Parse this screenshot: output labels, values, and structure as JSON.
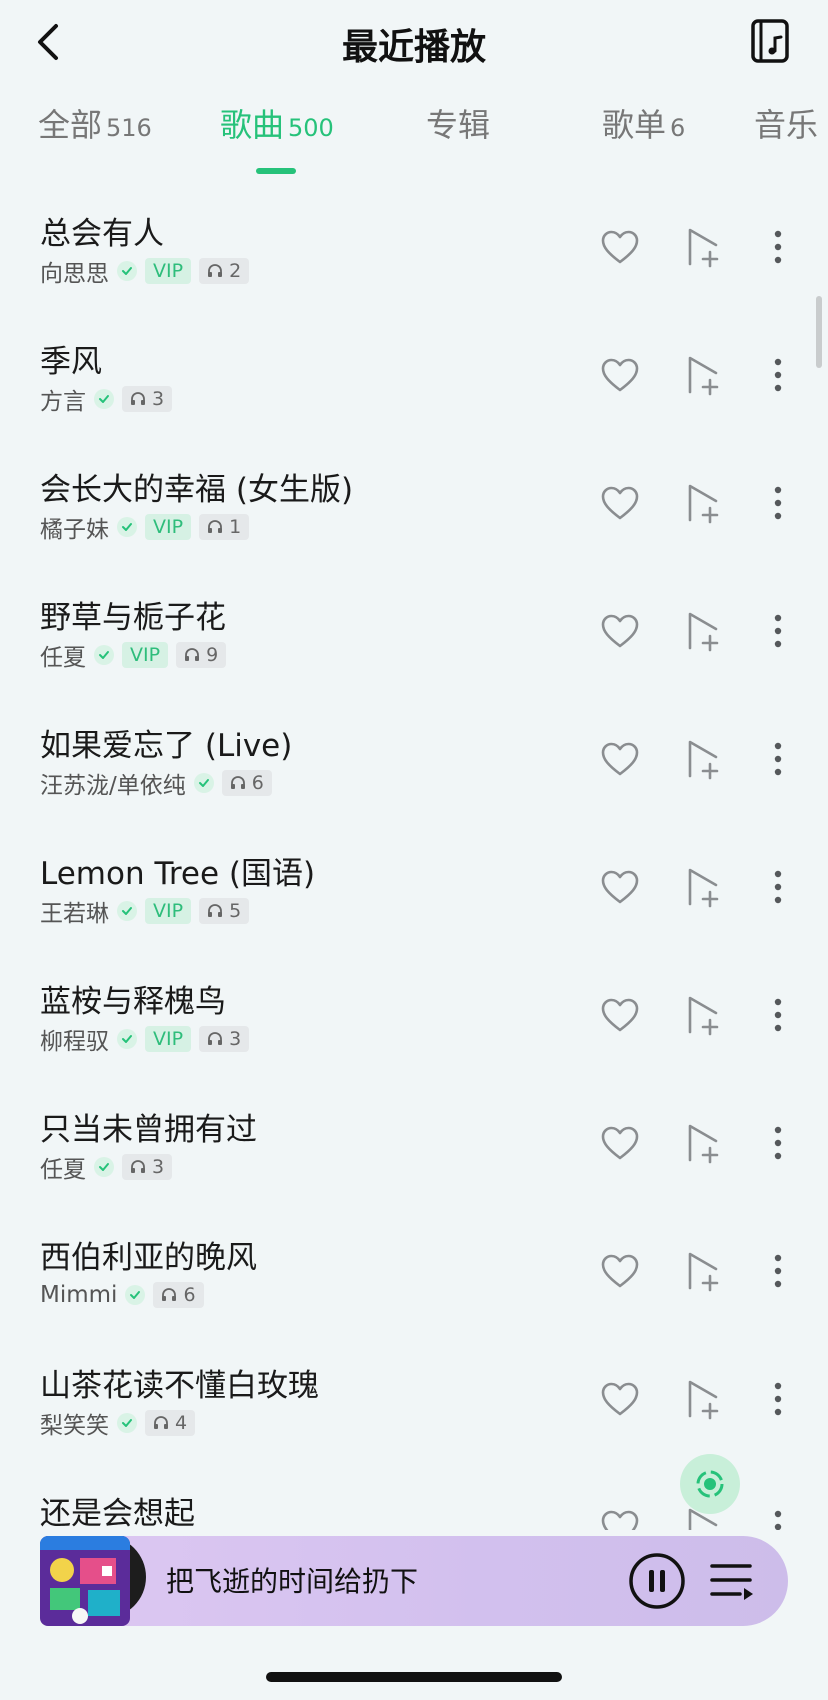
{
  "header": {
    "title": "最近播放"
  },
  "tabs": [
    {
      "label": "全部",
      "count": "516",
      "active": false
    },
    {
      "label": "歌曲",
      "count": "500",
      "active": true
    },
    {
      "label": "专辑",
      "count": "",
      "active": false
    },
    {
      "label": "歌单",
      "count": "6",
      "active": false
    },
    {
      "label": "音乐",
      "count": "",
      "active": false
    }
  ],
  "songs": [
    {
      "title": "总会有人",
      "artist": "向思思",
      "vip": "VIP",
      "plays": "2"
    },
    {
      "title": "季风",
      "artist": "方言",
      "vip": "",
      "plays": "3"
    },
    {
      "title": "会长大的幸福 (女生版)",
      "artist": "橘子妹",
      "vip": "VIP",
      "plays": "1"
    },
    {
      "title": "野草与栀子花",
      "artist": "任夏",
      "vip": "VIP",
      "plays": "9"
    },
    {
      "title": "如果爱忘了 (Live)",
      "artist": "汪苏泷/单依纯",
      "vip": "",
      "plays": "6"
    },
    {
      "title": "Lemon Tree (国语)",
      "artist": "王若琳",
      "vip": "VIP",
      "plays": "5"
    },
    {
      "title": "蓝桉与释槐鸟",
      "artist": "柳程驭",
      "vip": "VIP",
      "plays": "3"
    },
    {
      "title": "只当未曾拥有过",
      "artist": "任夏",
      "vip": "",
      "plays": "3"
    },
    {
      "title": "西伯利亚的晚风",
      "artist": "Mimmi",
      "vip": "",
      "plays": "6"
    },
    {
      "title": "山茶花读不懂白玫瑰",
      "artist": "梨笑笑",
      "vip": "",
      "plays": "4"
    },
    {
      "title": "还是会想起",
      "artist": "",
      "vip": "",
      "plays": ""
    }
  ],
  "player": {
    "now_playing": "把飞逝的时间给扔下"
  },
  "colors": {
    "accent": "#26c27a",
    "background": "#f1f6f7"
  },
  "icons": [
    "back-icon",
    "music-library-icon",
    "heart-icon",
    "add-to-playlist-icon",
    "more-icon",
    "locate-icon",
    "pause-icon",
    "playlist-queue-icon"
  ]
}
